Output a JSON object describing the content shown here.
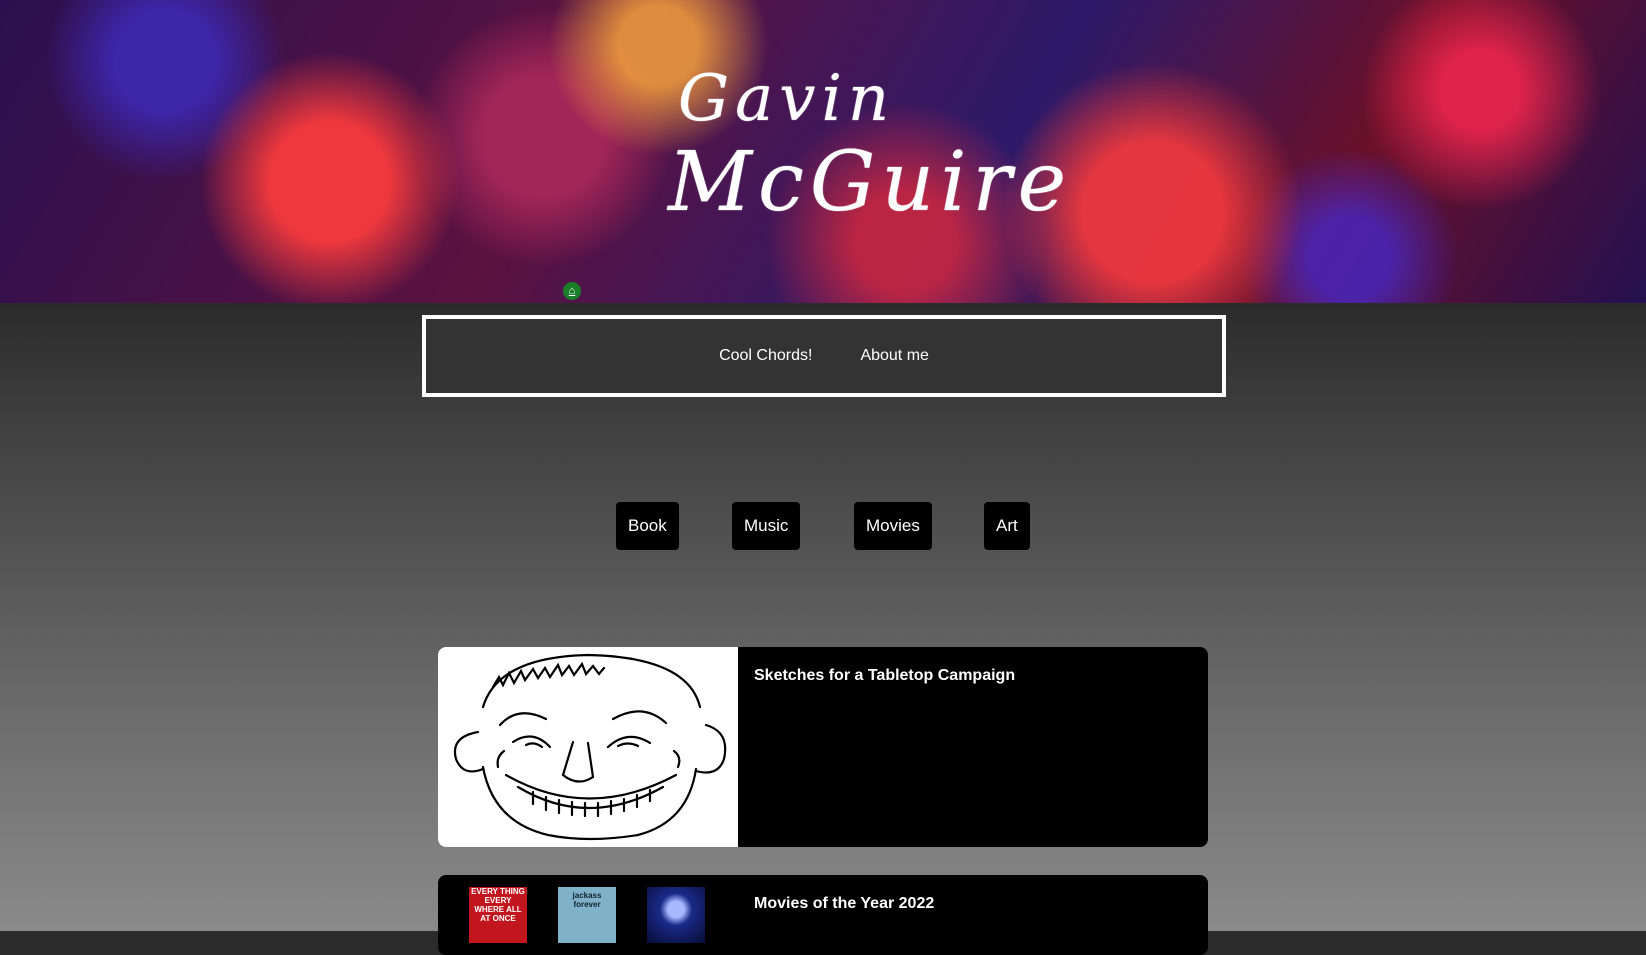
{
  "banner": {
    "name_first": "Gavin",
    "name_last": "McGuire",
    "home_icon": "home-icon"
  },
  "nav": {
    "items": [
      {
        "label": "Cool Chords!"
      },
      {
        "label": "About me"
      }
    ]
  },
  "filters": {
    "items": [
      {
        "label": "Book"
      },
      {
        "label": "Music"
      },
      {
        "label": "Movies"
      },
      {
        "label": "Art"
      }
    ]
  },
  "posts": [
    {
      "title": "Sketches for a Tabletop Campaign"
    },
    {
      "title": "Movies of the Year 2022",
      "posters": [
        {
          "text": "EVERY THING EVERY WHERE ALL AT ONCE"
        },
        {
          "text": "jackass forever"
        },
        {
          "text": ""
        }
      ]
    }
  ],
  "colors": {
    "card_bg": "#000000",
    "nav_border": "#ffffff",
    "page_top": "#2b2b2b",
    "page_bottom": "#8a8a8a"
  }
}
